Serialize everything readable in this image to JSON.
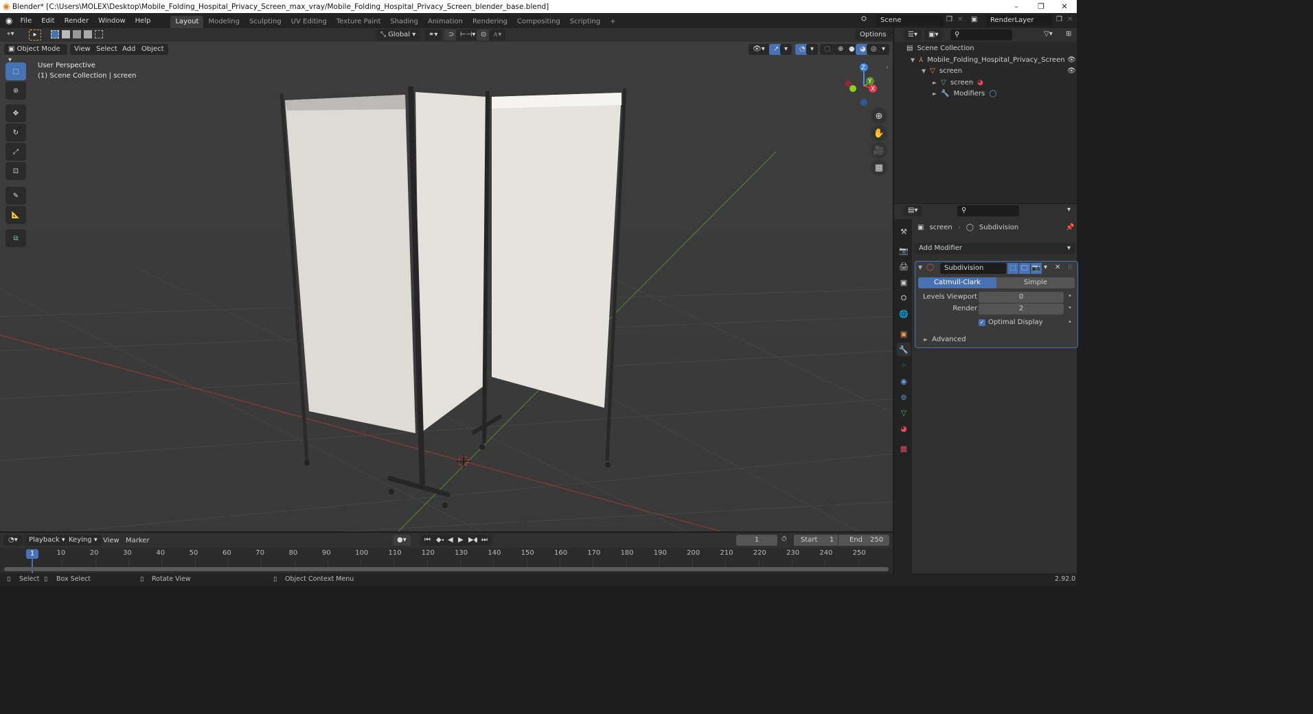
{
  "window": {
    "title": "Blender* [C:\\Users\\MOLEX\\Desktop\\Mobile_Folding_Hospital_Privacy_Screen_max_vray/Mobile_Folding_Hospital_Privacy_Screen_blender_base.blend]",
    "minimize": "–",
    "maximize": "❐",
    "close": "✕"
  },
  "menu": [
    "File",
    "Edit",
    "Render",
    "Window",
    "Help"
  ],
  "workspaces": [
    {
      "label": "Layout",
      "active": true
    },
    {
      "label": "Modeling"
    },
    {
      "label": "Sculpting"
    },
    {
      "label": "UV Editing"
    },
    {
      "label": "Texture Paint"
    },
    {
      "label": "Shading"
    },
    {
      "label": "Animation"
    },
    {
      "label": "Rendering"
    },
    {
      "label": "Compositing"
    },
    {
      "label": "Scripting"
    }
  ],
  "add_workspace": "+",
  "scene": {
    "label": "Scene"
  },
  "render_layer": {
    "label": "RenderLayer"
  },
  "viewport": {
    "transform_orientation": "Global",
    "options_label": "Options",
    "mode": "Object Mode",
    "menus": [
      "View",
      "Select",
      "Add",
      "Object"
    ],
    "overlay_title": "User Perspective",
    "overlay_subtitle": "(1) Scene Collection | screen",
    "gizmo": {
      "z": "Z",
      "y": "Y",
      "x": "X"
    }
  },
  "outliner": {
    "root": "Scene Collection",
    "items": [
      {
        "label": "Mobile_Folding_Hospital_Privacy_Screen",
        "depth": 1,
        "icon": "empty-axes-icon"
      },
      {
        "label": "screen",
        "depth": 2,
        "icon": "mesh-object-icon"
      },
      {
        "label": "screen",
        "depth": 3,
        "icon": "mesh-data-icon"
      },
      {
        "label": "Modifiers",
        "depth": 3,
        "icon": "wrench-icon"
      }
    ]
  },
  "properties": {
    "breadcrumb": [
      "screen",
      "Subdivision"
    ],
    "add_modifier": "Add Modifier",
    "modifier": {
      "name": "Subdivision",
      "algorithms": [
        {
          "label": "Catmull-Clark",
          "active": true
        },
        {
          "label": "Simple",
          "active": false
        }
      ],
      "levels_viewport_label": "Levels Viewport",
      "levels_viewport": "0",
      "render_label": "Render",
      "render": "2",
      "optimal_display_label": "Optimal Display",
      "optimal_display": true,
      "advanced_label": "Advanced"
    }
  },
  "timeline": {
    "menus": [
      "Playback",
      "Keying",
      "View",
      "Marker"
    ],
    "current_frame": "1",
    "start_label": "Start",
    "start": "1",
    "end_label": "End",
    "end": "250",
    "ticks": [
      "10",
      "20",
      "30",
      "40",
      "50",
      "60",
      "70",
      "80",
      "90",
      "100",
      "110",
      "120",
      "130",
      "140",
      "150",
      "160",
      "170",
      "180",
      "190",
      "200",
      "210",
      "220",
      "230",
      "240",
      "250"
    ]
  },
  "statusbar": {
    "items": [
      "Select",
      "Box Select",
      "Rotate View",
      "Object Context Menu"
    ],
    "version": "2.92.0"
  }
}
